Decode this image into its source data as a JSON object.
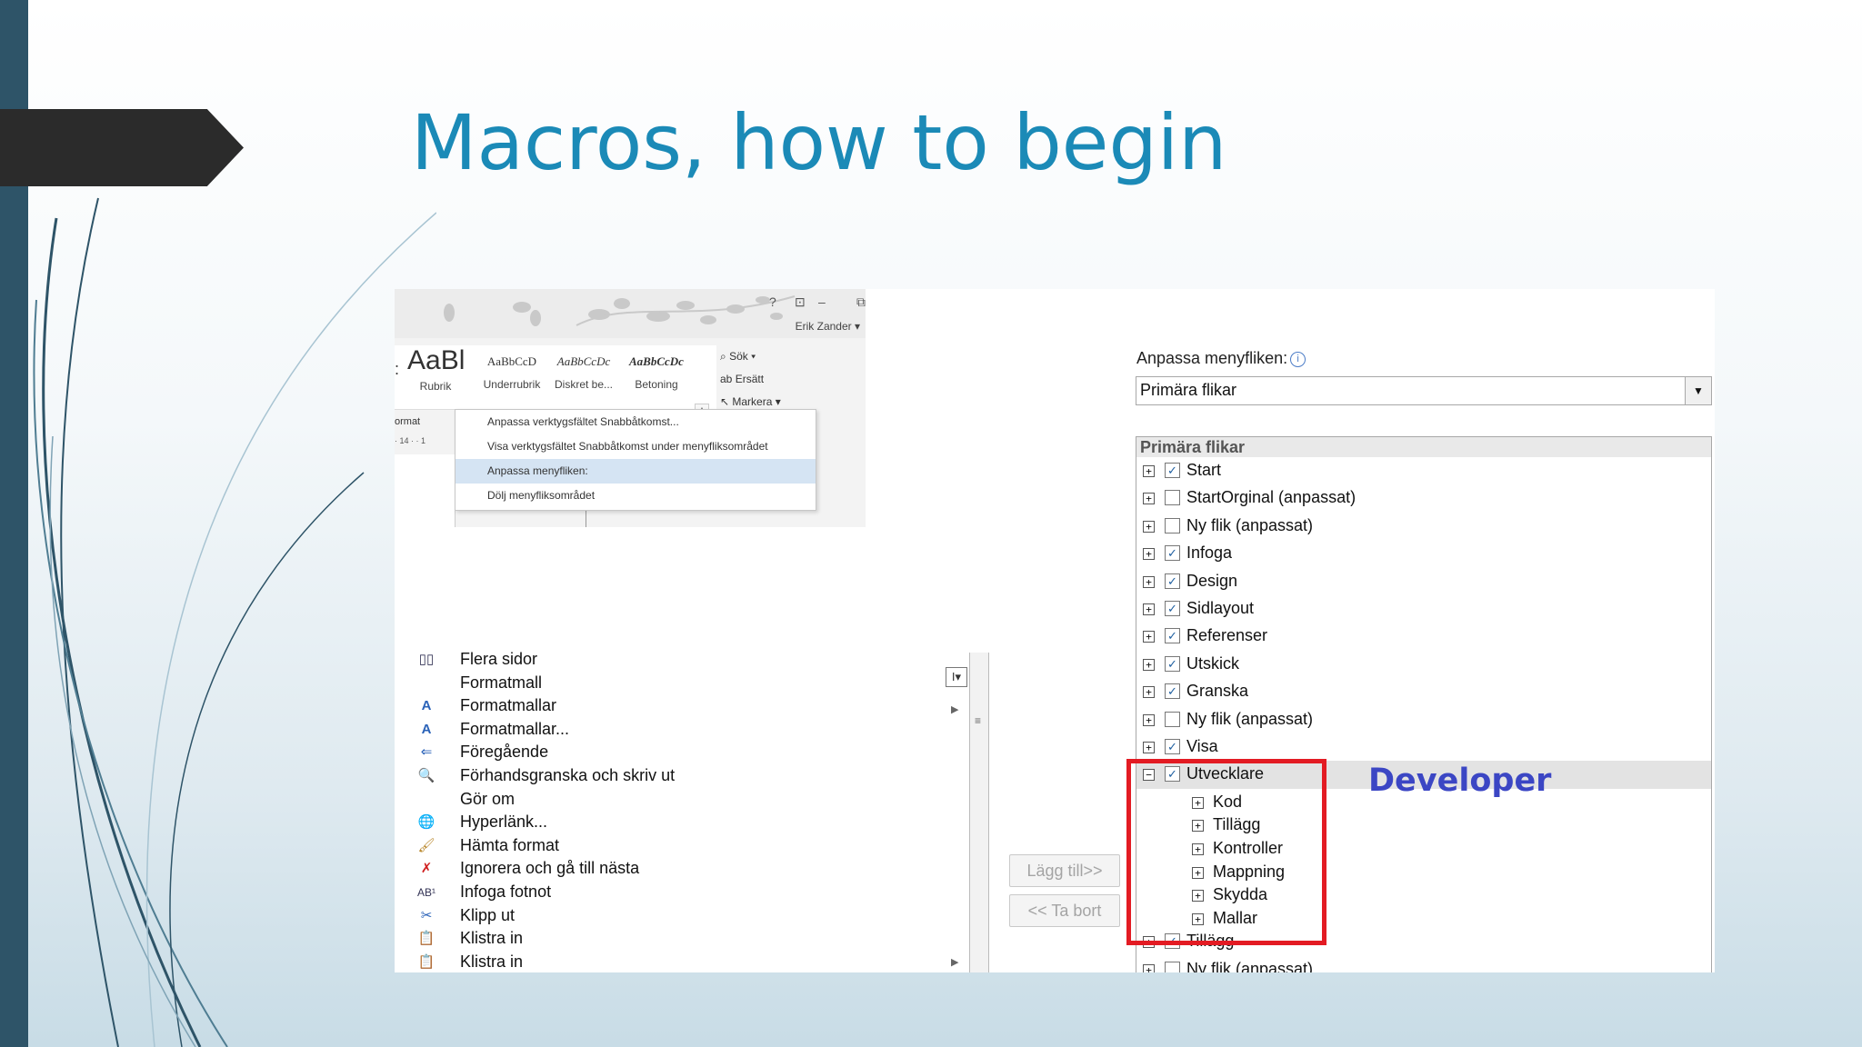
{
  "slide": {
    "title": "Macros, how to begin"
  },
  "colors": {
    "title": "#1b8ab7",
    "leftbar": "#2e5468",
    "highlight_box": "#e31b23",
    "developer_label": "#3b46c4"
  },
  "ribbon": {
    "user": "Erik Zander ▾",
    "window_controls": [
      "?",
      "⊡",
      "–",
      "⧉"
    ],
    "styles": [
      {
        "preview": "AaBl",
        "label": "Rubrik"
      },
      {
        "preview": "AaBbCcD",
        "label": "Underrubrik"
      },
      {
        "preview": "AaBbCcDc",
        "label": "Diskret be..."
      },
      {
        "preview": "AaBbCcDc",
        "label": "Betoning"
      }
    ],
    "editing": [
      {
        "icon": "binoculars-icon",
        "label": "Sök ▾"
      },
      {
        "icon": "replace-icon",
        "label": "Ersätt"
      },
      {
        "icon": "cursor-select-icon",
        "label": "Markera ▾"
      }
    ],
    "format_label": "ormat",
    "ruler": "· 14 · · 1",
    "context_menu": [
      "Anpassa verktygsfältet Snabbåtkomst...",
      "Visa verktygsfältet Snabbåtkomst under menyfliksområdet",
      "Anpassa menyfliken:",
      "Dölj menyfliksområdet"
    ]
  },
  "commands": [
    {
      "icon": "multiple-pages-icon",
      "glyph": "▯▯",
      "label": "Flera sidor"
    },
    {
      "icon": "",
      "glyph": "",
      "label": "Formatmall"
    },
    {
      "icon": "styles-icon",
      "glyph": "A",
      "label": "Formatmallar"
    },
    {
      "icon": "manage-styles-icon",
      "glyph": "A",
      "label": "Formatmallar..."
    },
    {
      "icon": "previous-icon",
      "glyph": "⇐",
      "label": "Föregående"
    },
    {
      "icon": "print-preview-icon",
      "glyph": "🔍",
      "label": "Förhandsgranska och skriv ut"
    },
    {
      "icon": "",
      "glyph": "",
      "label": "Gör om"
    },
    {
      "icon": "hyperlink-icon",
      "glyph": "🌐",
      "label": "Hyperlänk..."
    },
    {
      "icon": "format-painter-icon",
      "glyph": "🖌",
      "label": "Hämta format"
    },
    {
      "icon": "ignore-icon",
      "glyph": "✗",
      "label": "Ignorera och gå till nästa"
    },
    {
      "icon": "footnote-icon",
      "glyph": "AB¹",
      "label": "Infoga fotnot"
    },
    {
      "icon": "scissors-icon",
      "glyph": "✂",
      "label": "Klipp ut"
    },
    {
      "icon": "paste-icon",
      "glyph": "📋",
      "label": "Klistra in"
    },
    {
      "icon": "paste-icon",
      "glyph": "📋",
      "label": "Klistra in"
    }
  ],
  "buttons": {
    "add": "Lägg till>>",
    "remove": "<< Ta bort"
  },
  "customize": {
    "label": "Anpassa menyfliken:",
    "combo_value": "Primära flikar",
    "tree_header": "Primära flikar",
    "tabs": [
      {
        "label": "Start",
        "checked": true,
        "expanded": false,
        "level": 0
      },
      {
        "label": "StartOrginal (anpassat)",
        "checked": false,
        "expanded": false,
        "level": 0
      },
      {
        "label": "Ny flik (anpassat)",
        "checked": false,
        "expanded": false,
        "level": 0
      },
      {
        "label": "Infoga",
        "checked": true,
        "expanded": false,
        "level": 0
      },
      {
        "label": "Design",
        "checked": true,
        "expanded": false,
        "level": 0
      },
      {
        "label": "Sidlayout",
        "checked": true,
        "expanded": false,
        "level": 0
      },
      {
        "label": "Referenser",
        "checked": true,
        "expanded": false,
        "level": 0
      },
      {
        "label": "Utskick",
        "checked": true,
        "expanded": false,
        "level": 0
      },
      {
        "label": "Granska",
        "checked": true,
        "expanded": false,
        "level": 0
      },
      {
        "label": "Ny flik (anpassat)",
        "checked": false,
        "expanded": false,
        "level": 0
      },
      {
        "label": "Visa",
        "checked": true,
        "expanded": false,
        "level": 0
      },
      {
        "label": "Utvecklare",
        "checked": true,
        "expanded": true,
        "level": 0,
        "selected": true
      },
      {
        "label": "Kod",
        "level": 1
      },
      {
        "label": "Tillägg",
        "level": 1
      },
      {
        "label": "Kontroller",
        "level": 1
      },
      {
        "label": "Mappning",
        "level": 1
      },
      {
        "label": "Skydda",
        "level": 1
      },
      {
        "label": "Mallar",
        "level": 1
      },
      {
        "label": "Tillägg",
        "checked": true,
        "expanded": false,
        "level": 0
      },
      {
        "label": "Ny flik (anpassat)",
        "checked": false,
        "expanded": false,
        "level": 0
      }
    ],
    "annotation": "Developer"
  }
}
